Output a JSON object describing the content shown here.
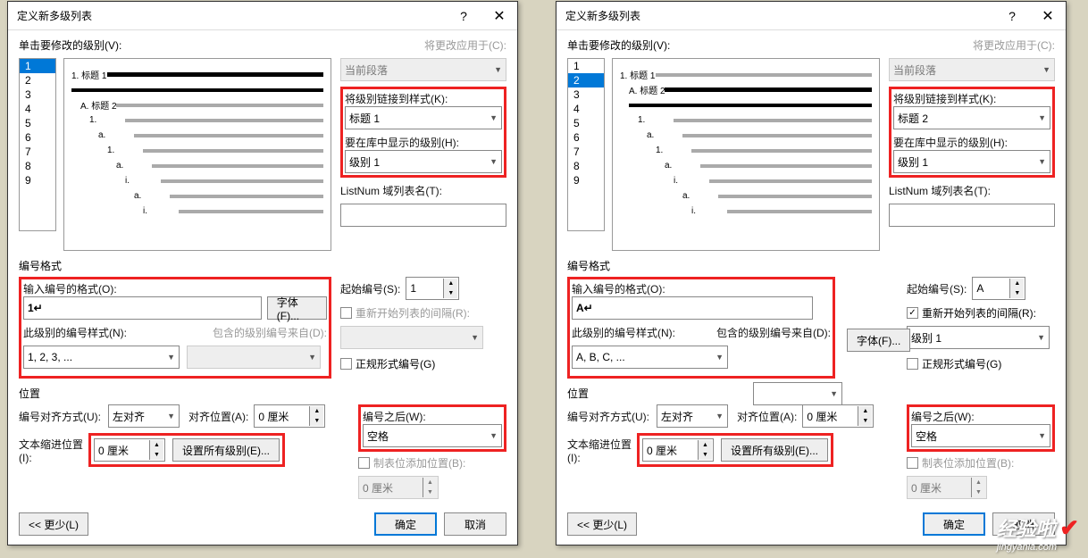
{
  "titlebar": {
    "title": "定义新多级列表",
    "help": "?",
    "close": "✕"
  },
  "labels": {
    "click_level": "单击要修改的级别(V):",
    "apply_to": "将更改应用于(C):",
    "apply_to_val": "当前段落",
    "link_style": "将级别链接到样式(K):",
    "show_level": "要在库中显示的级别(H):",
    "listnum": "ListNum 域列表名(T):",
    "number_format_group": "编号格式",
    "enter_format": "输入编号的格式(O):",
    "font_btn": "字体(F)...",
    "start_at": "起始编号(S):",
    "restart": "重新开始列表的间隔(R):",
    "this_level_style": "此级别的编号样式(N):",
    "include_from": "包含的级别编号来自(D):",
    "legal": "正规形式编号(G)",
    "position_group": "位置",
    "align": "编号对齐方式(U):",
    "align_val": "左对齐",
    "align_at": "对齐位置(A):",
    "zero_cm": "0 厘米",
    "follow": "编号之后(W):",
    "follow_val": "空格",
    "indent": "文本缩进位置(I):",
    "set_all": "设置所有级别(E)...",
    "tab_pos": "制表位添加位置(B):",
    "less": "<< 更少(L)",
    "ok": "确定",
    "cancel": "取消"
  },
  "left": {
    "link_style_val": "标题 1",
    "show_level_val": "级别 1",
    "format_val": "1↵",
    "start_val": "1",
    "style_val": "1, 2, 3, ...",
    "restart_val": "",
    "restart_checked": false,
    "selected_level": "1"
  },
  "right": {
    "link_style_val": "标题 2",
    "show_level_val": "级别 1",
    "format_val": "A↵",
    "start_val": "A",
    "style_val": "A, B, C, ...",
    "restart_val": "级别 1",
    "restart_checked": true,
    "selected_level": "2"
  },
  "levels": [
    "1",
    "2",
    "3",
    "4",
    "5",
    "6",
    "7",
    "8",
    "9"
  ],
  "preview": {
    "lines": [
      {
        "indent": 0,
        "bullet": "1.",
        "label": "标题 1",
        "bold": true
      },
      {
        "indent": 0,
        "bullet": "",
        "label": "",
        "bold": true,
        "double": true
      },
      {
        "indent": 1,
        "bullet": "A.",
        "label": "标题 2"
      },
      {
        "indent": 2,
        "bullet": "1."
      },
      {
        "indent": 3,
        "bullet": "a."
      },
      {
        "indent": 4,
        "bullet": "1."
      },
      {
        "indent": 5,
        "bullet": "a."
      },
      {
        "indent": 6,
        "bullet": "i."
      },
      {
        "indent": 7,
        "bullet": "a."
      },
      {
        "indent": 8,
        "bullet": "i."
      }
    ]
  },
  "watermark": {
    "brand": "经验啦",
    "url": "jingyanla.com"
  }
}
